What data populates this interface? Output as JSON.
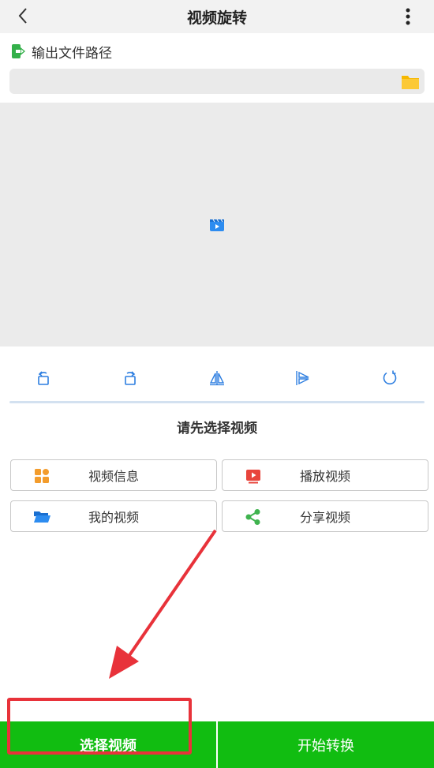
{
  "header": {
    "title": "视频旋转",
    "back_icon": "chevron-left-icon",
    "more_icon": "more-vertical-icon"
  },
  "output": {
    "label": "输出文件路径",
    "path_value": "",
    "path_placeholder": ""
  },
  "rotation_tools": [
    "rotate-left-icon",
    "rotate-right-icon",
    "flip-horizontal-icon",
    "flip-vertical-icon",
    "reset-rotate-icon"
  ],
  "hint": "请先选择视频",
  "actions": {
    "video_info": "视频信息",
    "play_video": "播放视频",
    "my_videos": "我的视频",
    "share_video": "分享视频"
  },
  "bottom": {
    "select_video": "选择视频",
    "start_convert": "开始转换"
  },
  "colors": {
    "accent_green": "#11bd11",
    "folder_yellow": "#f9c72a",
    "icon_blue": "#2d8cf0",
    "highlight_red": "#e8323a"
  }
}
